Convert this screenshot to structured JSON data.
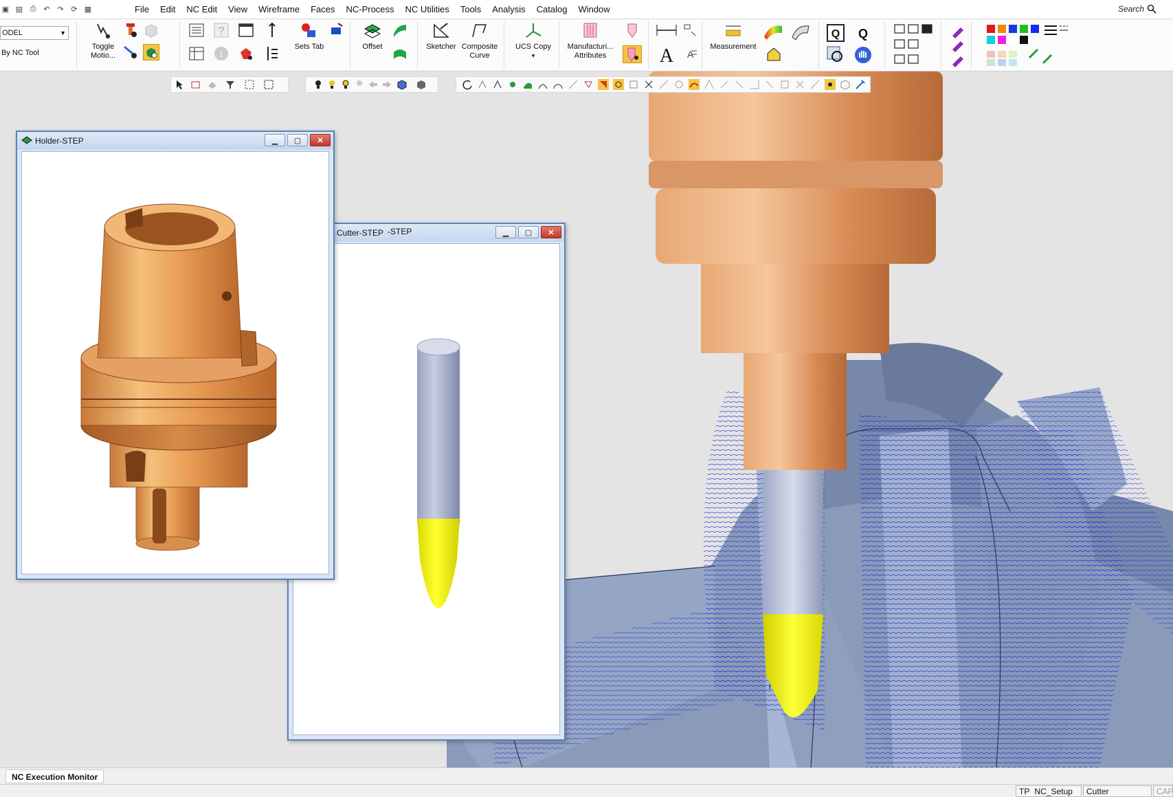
{
  "menubar": {
    "items": [
      "File",
      "Edit",
      "NC Edit",
      "View",
      "Wireframe",
      "Faces",
      "NC-Process",
      "NC Utilities",
      "Tools",
      "Analysis",
      "Catalog",
      "Window"
    ],
    "search_label": "Search"
  },
  "ribbon": {
    "model_select_value": "ODEL",
    "bytool_label": "By NC Tool",
    "toggle_motion": "Toggle Motio...",
    "sets_tab": "Sets Tab",
    "offset": "Offset",
    "sketcher": "Sketcher",
    "composite_curve": "Composite Curve",
    "ucs_copy": "UCS Copy",
    "manufacturing_attributes": "Manufacturi... Attributes",
    "measurement": "Measurement"
  },
  "windows": {
    "holder_title": "Holder-STEP",
    "cutter_title": "Cutter-STEP",
    "cutter_title_ghost": "-STEP"
  },
  "bottom": {
    "exec_tab": "NC Execution Monitor",
    "status_tp": "TP",
    "status_setup": "NC_Setup",
    "status_cutter": "Cutter",
    "status_cap": "CAP"
  },
  "colors": {
    "holder_copper": "#d98a45",
    "cutter_shank": "#a9afd0",
    "cutter_tip": "#f0f000",
    "part_steel": "#8597b8",
    "toolpath_blue": "#1c2fd6",
    "window_border": "#5b82b8",
    "close_red": "#c2372a"
  }
}
